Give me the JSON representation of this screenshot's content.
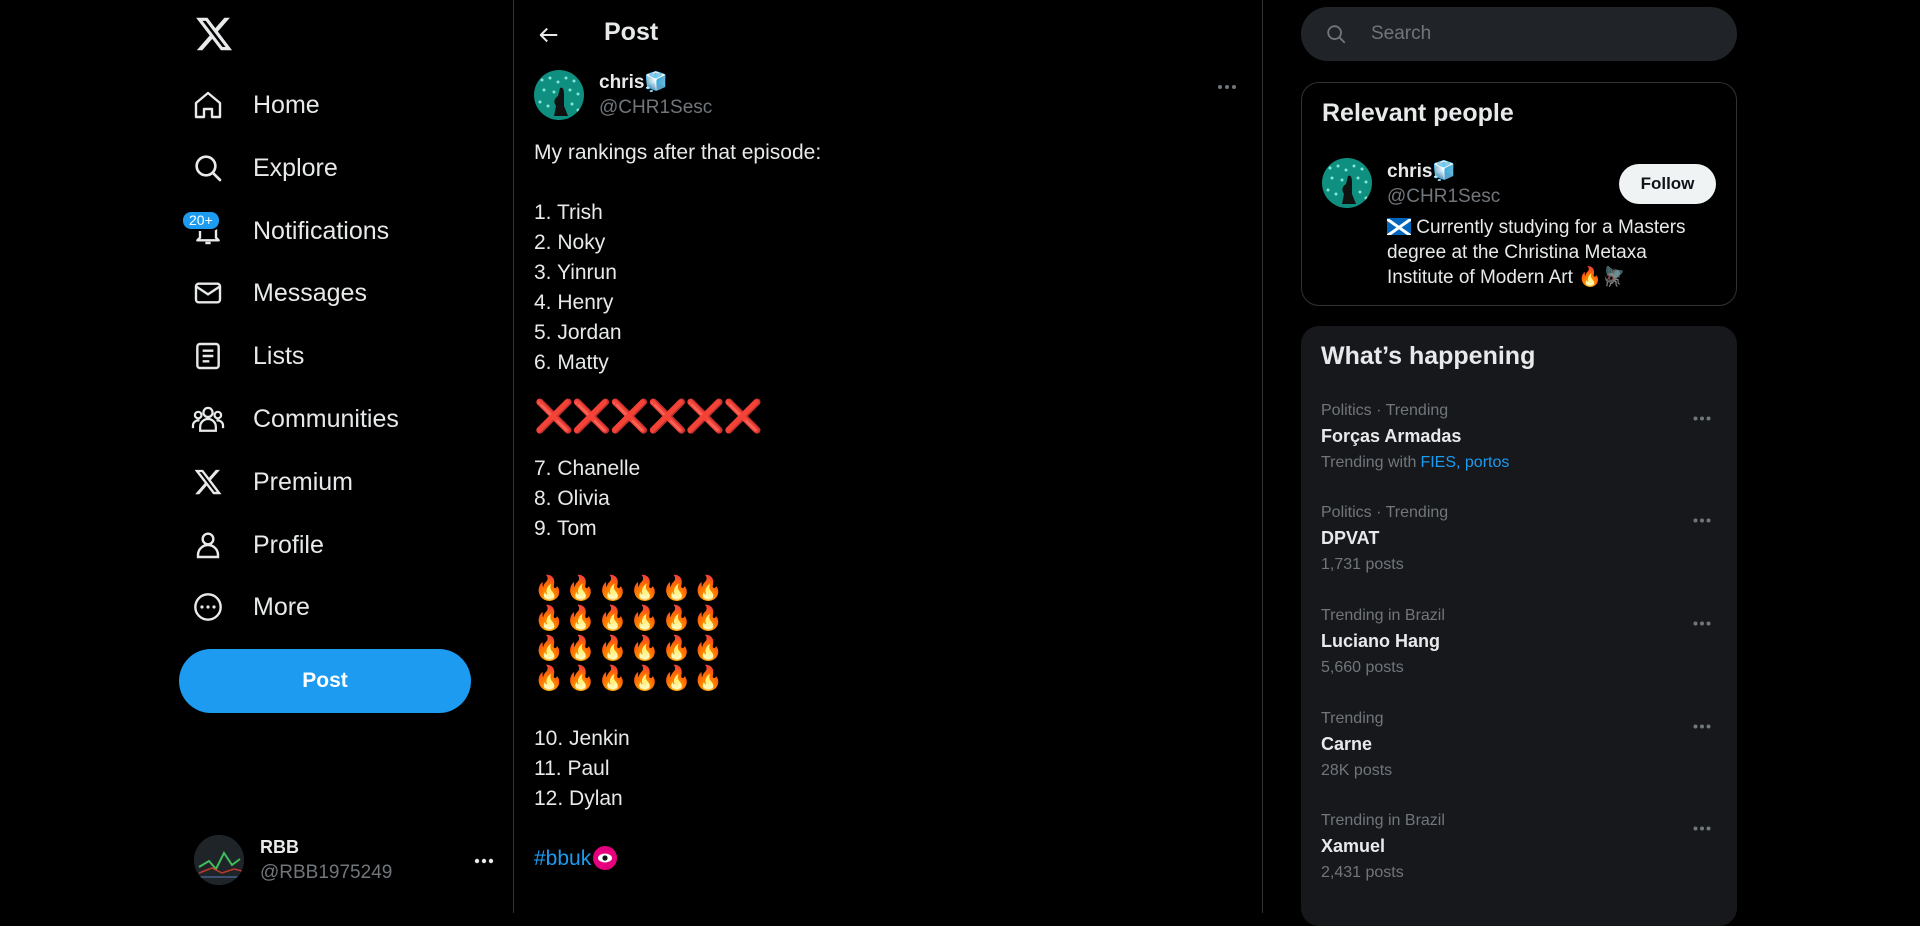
{
  "nav": {
    "items": [
      {
        "label": "Home",
        "icon": "home-icon"
      },
      {
        "label": "Explore",
        "icon": "search-icon"
      },
      {
        "label": "Notifications",
        "icon": "bell-icon",
        "badge": "20+"
      },
      {
        "label": "Messages",
        "icon": "mail-icon"
      },
      {
        "label": "Lists",
        "icon": "list-icon"
      },
      {
        "label": "Communities",
        "icon": "people-icon"
      },
      {
        "label": "Premium",
        "icon": "x-logo-icon"
      },
      {
        "label": "Profile",
        "icon": "person-icon"
      },
      {
        "label": "More",
        "icon": "more-circle-icon"
      }
    ],
    "post_label": "Post",
    "account": {
      "name": "RBB",
      "handle": "@RBB1975249"
    }
  },
  "main": {
    "title": "Post",
    "author": {
      "name": "chris🧊",
      "handle": "@CHR1Sesc"
    },
    "post": {
      "intro": "My rankings after that episode:",
      "group1": [
        "1. Trish",
        "2. Noky",
        "3. Yinrun",
        "4. Henry",
        "5. Jordan",
        "6. Matty"
      ],
      "crosses": "❌❌❌❌❌❌",
      "group2": [
        "7. Chanelle",
        "8. Olivia",
        "9. Tom"
      ],
      "fire_rows": [
        "🔥🔥🔥🔥🔥🔥",
        "🔥🔥🔥🔥🔥🔥",
        "🔥🔥🔥🔥🔥🔥",
        "🔥🔥🔥🔥🔥🔥"
      ],
      "group3": [
        "10. Jenkin",
        "11. Paul",
        "12. Dylan"
      ],
      "hashtag": "#bbuk"
    }
  },
  "search": {
    "placeholder": "Search"
  },
  "relevant": {
    "title": "Relevant people",
    "name": "chris🧊",
    "handle": "@CHR1Sesc",
    "follow_label": "Follow",
    "bio": "Currently studying for a Masters degree at the Christina Metaxa Institute of Modern Art 🔥🪰"
  },
  "happening": {
    "title": "What’s happening",
    "trends": [
      {
        "context": "Politics · Trending",
        "title": "Forças Armadas",
        "count_prefix": "Trending with",
        "links": "FIES, portos"
      },
      {
        "context": "Politics · Trending",
        "title": "DPVAT",
        "count": "1,731 posts"
      },
      {
        "context": "Trending in Brazil",
        "title": "Luciano Hang",
        "count": "5,660 posts"
      },
      {
        "context": "Trending",
        "title": "Carne",
        "count": "28K posts"
      },
      {
        "context": "Trending in Brazil",
        "title": "Xamuel",
        "count": "2,431 posts"
      }
    ]
  },
  "colors": {
    "accent": "#1d9bf0",
    "background": "#000000",
    "text": "#e7e9ea",
    "muted": "#71767b",
    "danger": "#f4212e"
  }
}
